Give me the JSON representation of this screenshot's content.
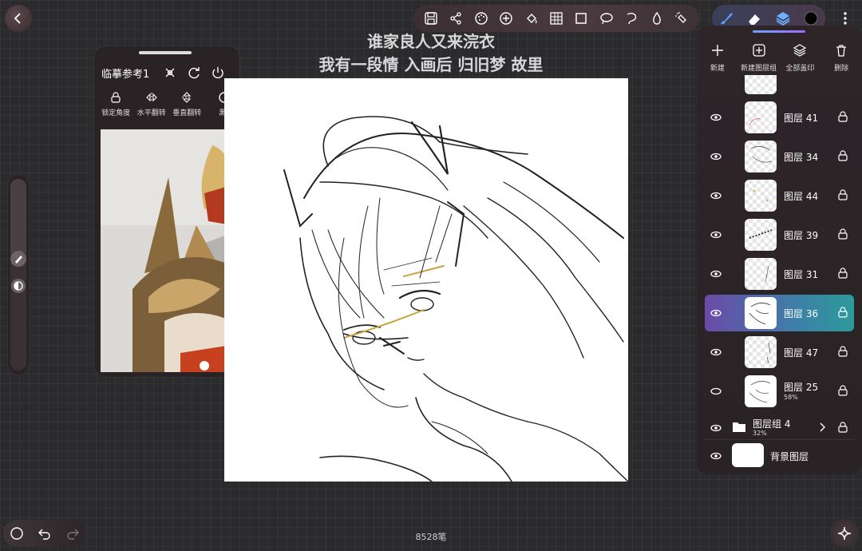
{
  "canvas": {
    "stroke_count": "8528笔"
  },
  "lyric": {
    "line1": "谁家良人又来浣衣",
    "line2": "我有一段情 入画后 归旧梦 故里"
  },
  "reference": {
    "title": "临摹参考1",
    "tools": [
      {
        "label": "锁定角度",
        "icon": "lock-rotate-icon"
      },
      {
        "label": "水平翻转",
        "icon": "flip-horizontal-icon"
      },
      {
        "label": "垂直翻转",
        "icon": "flip-vertical-icon"
      },
      {
        "label": "黑",
        "icon": "half-circle-icon"
      }
    ]
  },
  "layers_panel": {
    "actions": [
      {
        "label": "新建",
        "icon": "plus-icon"
      },
      {
        "label": "新建图层组",
        "icon": "add-group-icon"
      },
      {
        "label": "全部盖印",
        "icon": "stamp-icon"
      },
      {
        "label": "删除",
        "icon": "trash-icon"
      }
    ],
    "layers": [
      {
        "name": "图层 41",
        "visible": true,
        "active": false,
        "opacity": ""
      },
      {
        "name": "图层 34",
        "visible": true,
        "active": false,
        "opacity": ""
      },
      {
        "name": "图层 44",
        "visible": true,
        "active": false,
        "opacity": ""
      },
      {
        "name": "图层 39",
        "visible": true,
        "active": false,
        "opacity": ""
      },
      {
        "name": "图层 31",
        "visible": true,
        "active": false,
        "opacity": ""
      },
      {
        "name": "图层 36",
        "visible": true,
        "active": true,
        "opacity": ""
      },
      {
        "name": "图层 47",
        "visible": true,
        "active": false,
        "opacity": ""
      },
      {
        "name": "图层 25",
        "visible": false,
        "active": false,
        "opacity": "58%"
      }
    ],
    "group": {
      "name": "图层组 4",
      "opacity": "32%"
    },
    "background": {
      "name": "背景图层"
    }
  },
  "colors": {
    "accent_start": "#6b4aa8",
    "accent_end": "#2c9a9a",
    "brush_blue": "#5aa0ff"
  },
  "toolbar_icons": [
    "save-icon",
    "share-icon",
    "palette-icon",
    "plus-circle-icon",
    "fill-icon",
    "grid-icon",
    "rect-select-icon",
    "lasso-icon",
    "lasso-alt-icon",
    "droplet-icon",
    "spray-icon"
  ]
}
